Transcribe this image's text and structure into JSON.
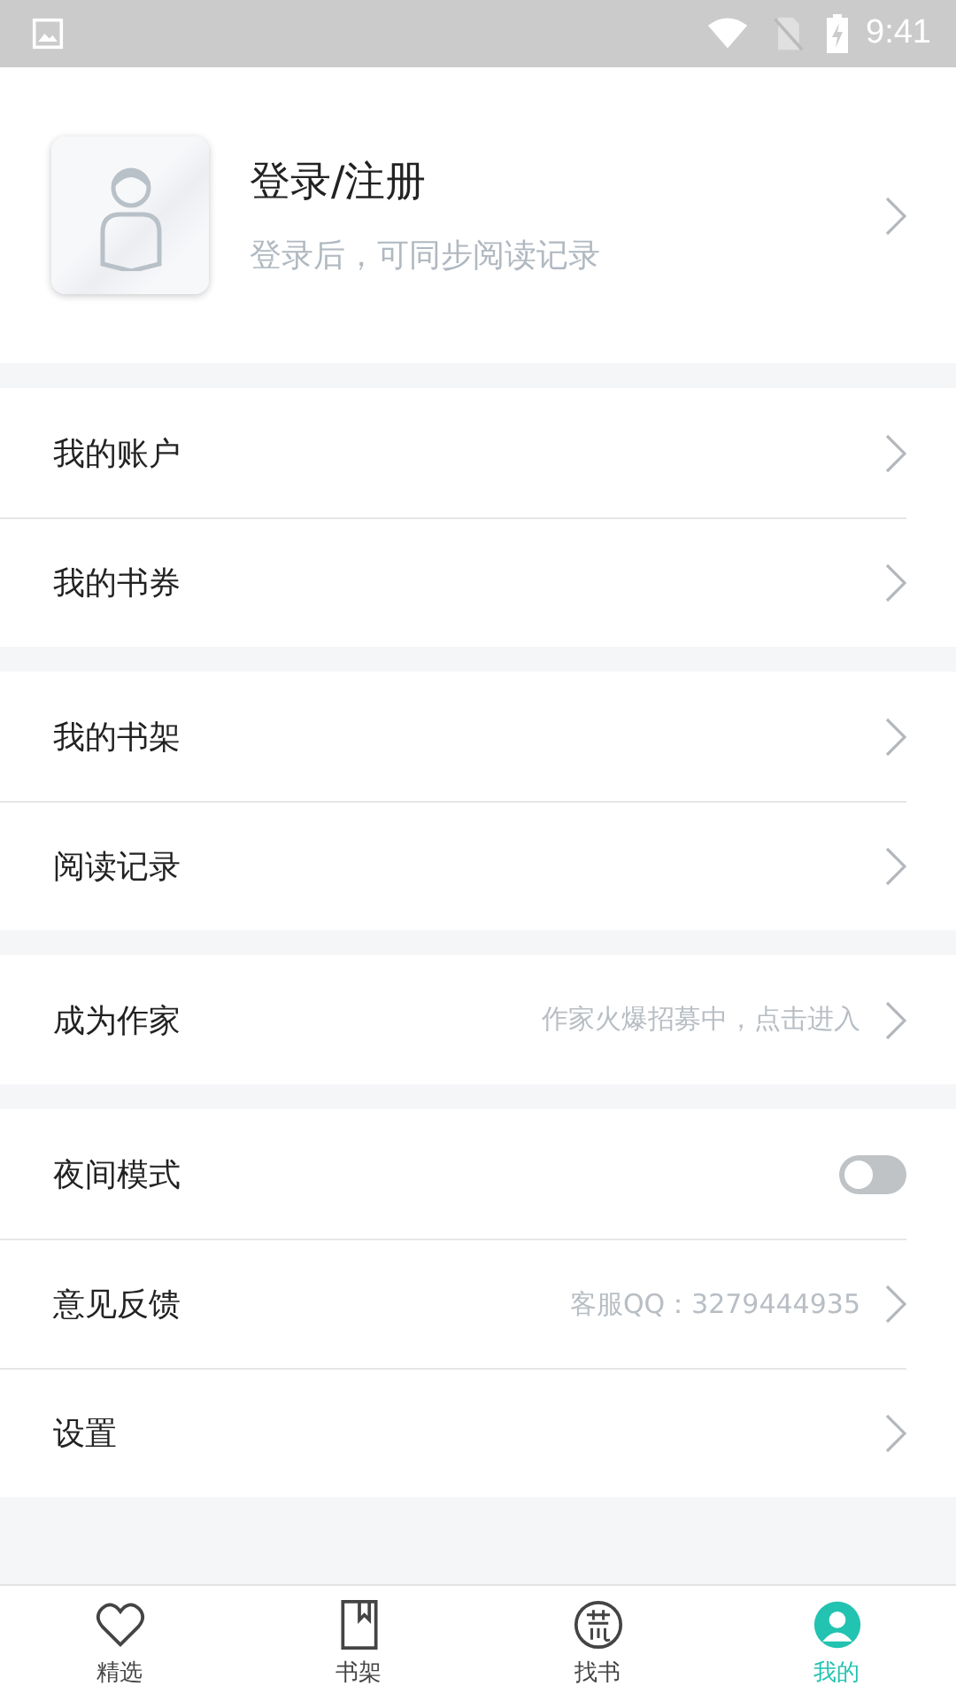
{
  "status_bar": {
    "time": "9:41"
  },
  "profile": {
    "title": "登录/注册",
    "subtitle": "登录后，可同步阅读记录"
  },
  "groups": [
    [
      {
        "kind": "link",
        "label": "我的账户"
      },
      {
        "kind": "link",
        "label": "我的书券"
      }
    ],
    [
      {
        "kind": "link",
        "label": "我的书架"
      },
      {
        "kind": "link",
        "label": "阅读记录"
      }
    ],
    [
      {
        "kind": "link",
        "label": "成为作家",
        "detail": "作家火爆招募中，点击进入"
      }
    ],
    [
      {
        "kind": "toggle",
        "label": "夜间模式",
        "on": false
      },
      {
        "kind": "link",
        "label": "意见反馈",
        "detail": "客服QQ：3279444935"
      },
      {
        "kind": "link",
        "label": "设置"
      }
    ]
  ],
  "tabs": [
    {
      "label": "精选",
      "kind": "featured",
      "selected": false
    },
    {
      "label": "书架",
      "kind": "shelf",
      "selected": false
    },
    {
      "label": "找书",
      "kind": "find",
      "selected": false
    },
    {
      "label": "我的",
      "kind": "mine",
      "selected": true
    }
  ]
}
